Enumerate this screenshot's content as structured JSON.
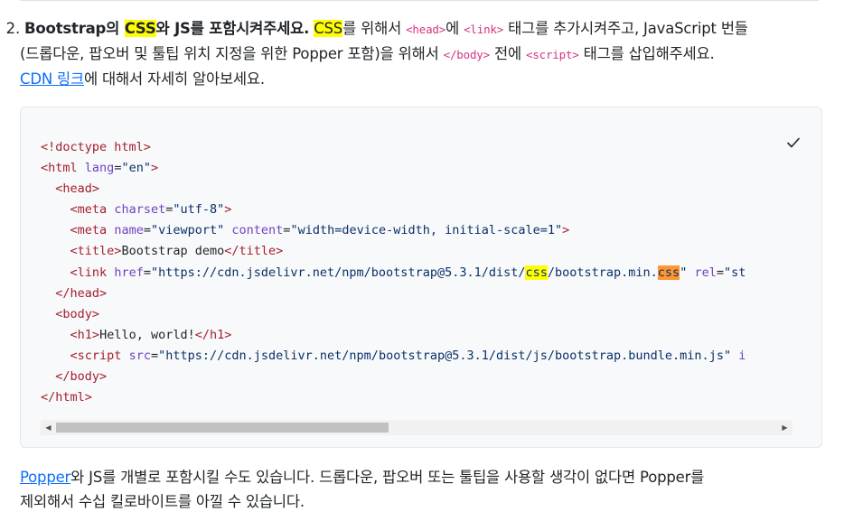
{
  "step": {
    "number": "2.",
    "bold_a": "Bootstrap의 ",
    "bold_css": "CSS",
    "bold_b": "와 JS를 포함시켜주세요.",
    "sp1": " ",
    "css_word": "CSS",
    "t1": "를 위해서 ",
    "head_tag": "<head>",
    "t2": "에 ",
    "link_tag": "<link>",
    "t3": " 태그를 추가시켜주고, JavaScript 번들",
    "t4": "(드롭다운, 팝오버 및 툴팁 위치 지정을 위한 Popper 포함)을 위해서 ",
    "body_close_tag": "</body>",
    "t5": " 전에 ",
    "script_tag": "<script>",
    "t6": " 태그를 삽입해주세요.",
    "cdn_link": "CDN 링크",
    "t7": "에 대해서 자세히 알아보세요."
  },
  "code": {
    "doctype": "<!doctype html>",
    "html_open": "html",
    "lang_attr": "lang",
    "lang_val": "\"en\"",
    "head": "head",
    "meta": "meta",
    "charset_attr": "charset",
    "charset_val": "\"utf-8\"",
    "name_attr": "name",
    "name_val": "\"viewport\"",
    "content_attr": "content",
    "content_val": "\"width=device-width, initial-scale=1\"",
    "title": "title",
    "title_text": "Bootstrap demo",
    "link": "link",
    "href_attr": "href",
    "href_a": "\"https://cdn.jsdelivr.net/npm/bootstrap@5.3.1/dist/",
    "href_css1": "css",
    "href_b": "/bootstrap.min.",
    "href_css2": "css",
    "href_c": "\"",
    "rel_attr": "rel",
    "rel_val": "\"st",
    "body": "body",
    "h1": "h1",
    "h1_text": "Hello, world!",
    "script": "script",
    "src_attr": "src",
    "src_val": "\"https://cdn.jsdelivr.net/npm/bootstrap@5.3.1/dist/js/bootstrap.bundle.min.js\"",
    "script_trail": "i",
    "html_close": "html"
  },
  "scrollbar": {
    "left_arrow": "◀",
    "right_arrow": "▶"
  },
  "note": {
    "popper_link": "Popper",
    "t1": "와 JS를 개별로 포함시킬 수도 있습니다. 드롭다운, 팝오버 또는 툴팁을 사용할 생각이 없다면 Popper를",
    "t2": "제외해서 수십 킬로바이트를 아낄 수 있습니다."
  },
  "colors": {
    "highlight_yellow": "#ffff00",
    "highlight_orange": "#ff9632",
    "link_blue": "#0d6efd",
    "inline_code": "#d63384"
  },
  "icons": {
    "copy_button": "checkmark-icon"
  }
}
